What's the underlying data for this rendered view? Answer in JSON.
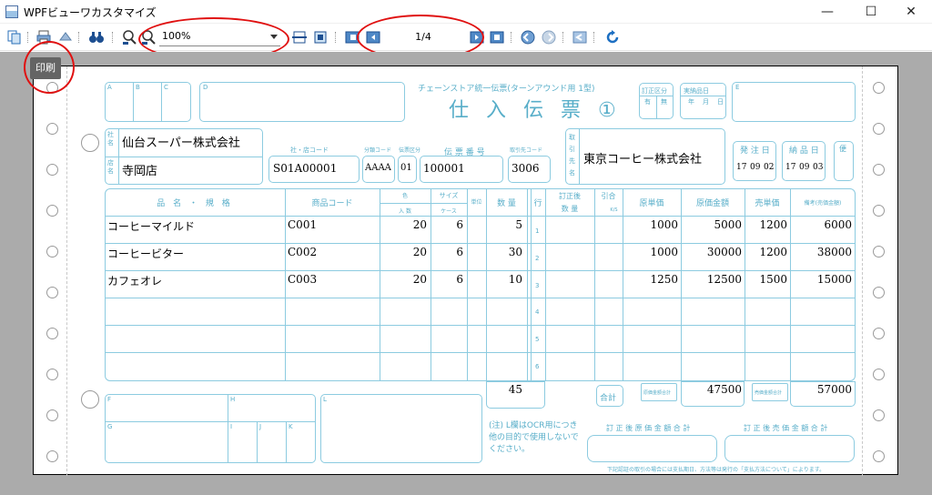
{
  "window": {
    "title": "WPFビューワカスタマイズ",
    "controls": [
      "—",
      "☐",
      "✕"
    ]
  },
  "toolbar": {
    "icons": [
      "copy-icon",
      "print-icon",
      "export-icon",
      "search-binoculars-icon",
      "zoom-out-icon",
      "zoom-in-icon",
      "fit-width-icon",
      "fit-page-icon",
      "first-page-icon",
      "previous-page-icon",
      "next-page-icon",
      "last-page-icon",
      "back-icon",
      "forward-icon",
      "exit-icon",
      "refresh-icon"
    ],
    "zoom_value": "100%",
    "page_value": "1/4"
  },
  "tooltip": "印刷",
  "form": {
    "title_small": "チェーンストア統一伝票(ターンアウンド用 1型)",
    "title_big": "仕 入 伝 票 ①",
    "box_letters": {
      "a": "A",
      "b": "B",
      "c": "C",
      "d": "D",
      "e": "E",
      "f": "F",
      "g": "G",
      "h": "H",
      "i": "I",
      "j": "J",
      "k": "K",
      "l": "L"
    },
    "labels": {
      "teisei": "訂正区分",
      "yu": "有",
      "mu": "無",
      "nohin_jitsu": "実納品日",
      "mdy": [
        "年",
        "月",
        "日"
      ],
      "shamei": "社名",
      "tenmei": "店名",
      "sha_ten_code": "社・店コード",
      "bunrui_code": "分類コード",
      "denpyo_kubun": "伝票区分",
      "denpyo_bango": "伝 票 番 号",
      "torihiki_code": "取引先コード",
      "torihikisaki": "取引先名",
      "hacchubi": "発 注 日",
      "nohinbi": "納 品 日",
      "bin": "便",
      "hinmei": "品 名 ・ 規 格",
      "shohin_code": "商品コード",
      "iro": "色",
      "size": "サイズ",
      "tani": "単位",
      "suryo": "数 量",
      "gyo": "行",
      "irisu": "入 数",
      "case": "ケース",
      "teisei_go": "訂正後",
      "teisei_suryo": "数 量",
      "hikiai": "引合",
      "ks": "K/S",
      "genka_tanka": "原単価",
      "genka_kingaku": "原価金額",
      "baika_tanka": "売単価",
      "biko": "備考(売価金額)",
      "gokei": "合計",
      "genka_gokei_label": "原価金額合計",
      "baika_gokei_label": "売価金額合計",
      "note": "(注) L欄はOCR用につき他の目的で使用しないでください。",
      "teisei_genka_gokei": "訂 正 後 原 価 金 額 合 計",
      "teisei_baika_gokei": "訂 正 後 売 価 金 額 合 計",
      "footer": "下記認証の取引の場合には支払期日、方法等は発行の「支払方法について」によります。"
    },
    "shamei": "仙台スーパー株式会社",
    "tenmei": "寺岡店",
    "sha_ten_code": "S01A00001",
    "bunrui_code": "AAAA",
    "denpyo_kubun": "01",
    "denpyo_bango": "100001",
    "torihiki_code": "3006",
    "torihikisaki": "東京コーヒー株式会社",
    "hacchubi": [
      "17",
      "09",
      "02"
    ],
    "nohinbi": [
      "17",
      "09",
      "03"
    ],
    "line_numbers": [
      "1",
      "2",
      "3",
      "4",
      "5",
      "6"
    ],
    "rows": [
      {
        "name": "コーヒーマイルド",
        "code": "C001",
        "irisu": "20",
        "case": "6",
        "qty": "5",
        "unit_cost": "1000",
        "cost": "5000",
        "unit_price": "1200",
        "price": "6000"
      },
      {
        "name": "コーヒービター",
        "code": "C002",
        "irisu": "20",
        "case": "6",
        "qty": "30",
        "unit_cost": "1000",
        "cost": "30000",
        "unit_price": "1200",
        "price": "38000"
      },
      {
        "name": "カフェオレ",
        "code": "C003",
        "irisu": "20",
        "case": "6",
        "qty": "10",
        "unit_cost": "1250",
        "cost": "12500",
        "unit_price": "1500",
        "price": "15000"
      }
    ],
    "total_qty": "45",
    "total_cost": "47500",
    "total_price": "57000"
  }
}
